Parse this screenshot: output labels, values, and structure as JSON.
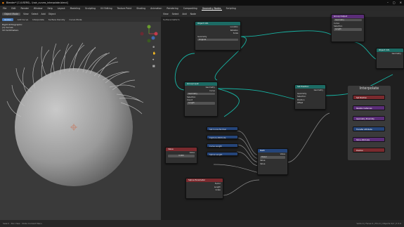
{
  "window": {
    "title": "Blender* [C:\\USERS\\...\\hair_curves_interpolate.blend]"
  },
  "workspaces": [
    "File",
    "Edit",
    "Render",
    "Window",
    "Help",
    "Layout",
    "Modeling",
    "Sculpting",
    "UV Editing",
    "Texture Paint",
    "Shading",
    "Animation",
    "Rendering",
    "Compositing",
    "Geometry Nodes",
    "Scripting"
  ],
  "active_workspace": "Geometry Nodes",
  "viewport": {
    "header": [
      "Object Mode",
      "View",
      "Select",
      "Add",
      "Object"
    ],
    "header2": [
      "Global",
      "Add Curve",
      "Interpolate",
      "Surface Density",
      "Curve Mode"
    ],
    "info": [
      "Right Orthographic",
      "(1) Curves",
      "10 Centimeters"
    ]
  },
  "node_editor": {
    "header": [
      "View",
      "Select",
      "Add",
      "Node"
    ],
    "breadcrumb": "Surface Deform",
    "nodes": {
      "object_info": {
        "title": "Object Info",
        "rows": [
          "Location",
          "Rotation",
          "Scale",
          "Geometry"
        ],
        "btns": [
          "Original",
          "Relative"
        ]
      },
      "group_input": {
        "title": "Group Input",
        "rows": [
          "Geometry"
        ]
      },
      "surface_object": {
        "title": "Object Info",
        "rows": [
          "Geometry",
          "Object"
        ]
      },
      "set_curve": {
        "title": "Set Position",
        "rows": [
          "Geometry",
          "Selection",
          "Position",
          "Offset"
        ]
      },
      "curve_to_points": {
        "title": "Resample Curve",
        "rows": [
          "Geometry",
          "Curve",
          "Selection",
          "Count",
          "Length"
        ]
      },
      "distribute": {
        "title": "Distribute Points on Faces",
        "rows": [
          "Geometry",
          "Distribute Points on Faces",
          "Points",
          "Normal",
          "Selection",
          "Density"
        ]
      },
      "value": {
        "title": "Value",
        "rows": [
          "Value"
        ],
        "val": "0.000"
      },
      "spline_param": {
        "title": "Spline Parameter",
        "rows": [
          "Factor",
          "Length",
          "Index"
        ]
      },
      "attrs": [
        "Set Curve Normal",
        "Capture Attribute",
        "Curve Length",
        "Spline Length"
      ],
      "math": {
        "title": "Math",
        "rows": [
          "Value",
          "Value",
          "Value"
        ],
        "op": "Power"
      },
      "group_output": {
        "title": "Group Output",
        "rows": [
          "Geometry"
        ]
      },
      "interpolate": {
        "title": "Interpolate",
        "items": [
          "Set Position",
          "Realize Instances",
          "Geometry Proximity",
          "Transfer Attribute",
          "Store Attribute",
          "Position"
        ]
      }
    }
  },
  "status": {
    "left": "Select  ·  Pan View  ·  Node Context Menu",
    "right": "Verts 0 | Faces 0 | Tris 0 | Objects 0/2 | 3.3.0"
  },
  "colors": {
    "accent": "#4a7fc1",
    "teal_link": "#17b3a3",
    "frame": "#3a3a3a"
  }
}
